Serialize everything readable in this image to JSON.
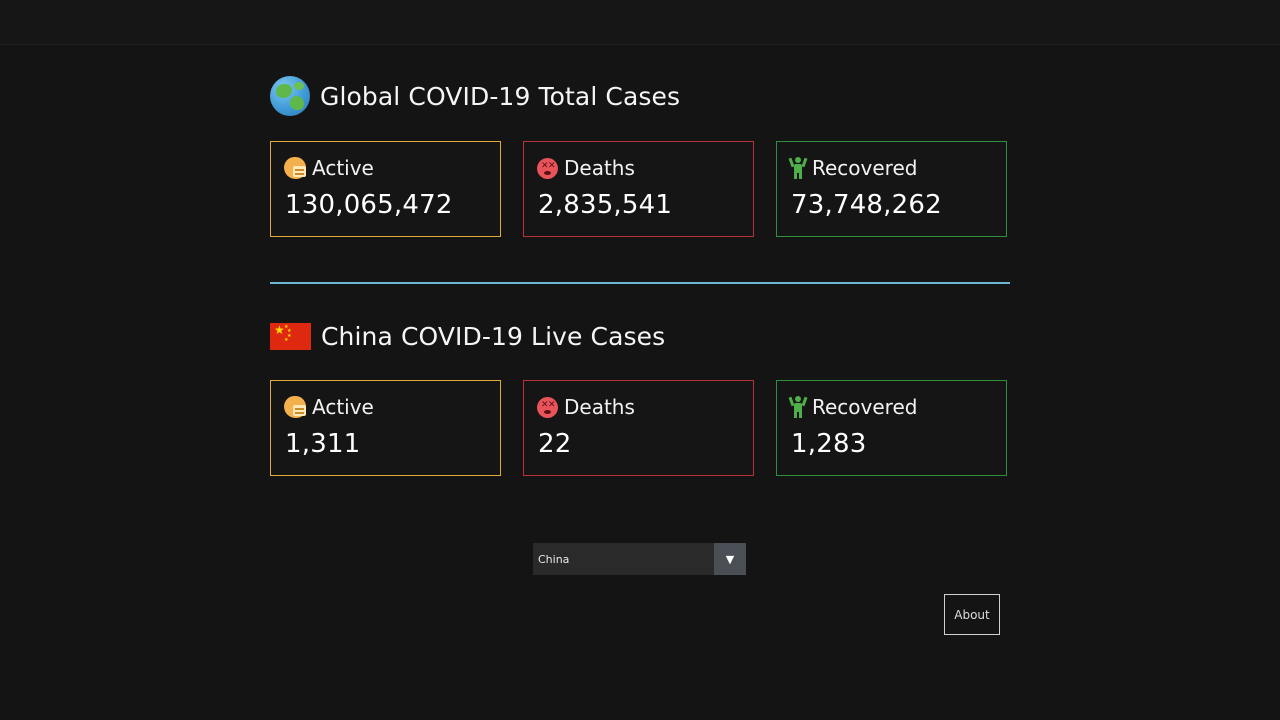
{
  "global": {
    "title": "Global COVID-19 Total Cases",
    "icon": "globe-icon",
    "stats": {
      "active": {
        "label": "Active",
        "value": "130,065,472"
      },
      "deaths": {
        "label": "Deaths",
        "value": "2,835,541"
      },
      "recovered": {
        "label": "Recovered",
        "value": "73,748,262"
      }
    }
  },
  "country": {
    "title": "China COVID-19 Live Cases",
    "icon": "china-flag-icon",
    "stats": {
      "active": {
        "label": "Active",
        "value": "1,311"
      },
      "deaths": {
        "label": "Deaths",
        "value": "22"
      },
      "recovered": {
        "label": "Recovered",
        "value": "1,283"
      }
    }
  },
  "country_select": {
    "selected": "China",
    "arrow": "▼"
  },
  "about_button": {
    "label": "About"
  },
  "colors": {
    "active": "#e3a93b",
    "deaths": "#b8323a",
    "recovered": "#2f8f3c",
    "divider": "#6fb7d6",
    "background": "#141414"
  }
}
